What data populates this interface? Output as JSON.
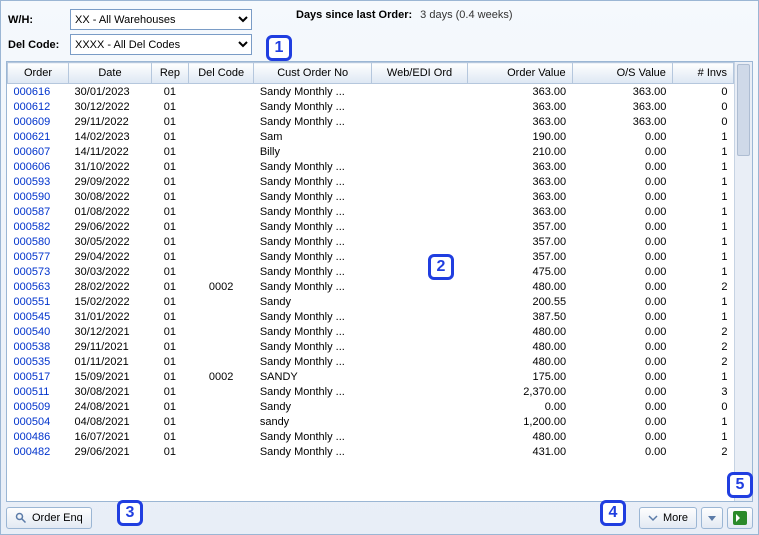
{
  "filters": {
    "wh_label": "W/H:",
    "wh_value": "XX - All Warehouses",
    "del_label": "Del Code:",
    "del_value": "XXXX - All Del Codes",
    "days_label": "Days since last Order:",
    "days_value": "3 days (0.4 weeks)"
  },
  "columns": [
    "Order",
    "Date",
    "Rep",
    "Del Code",
    "Cust Order No",
    "Web/EDI Ord",
    "Order Value",
    "O/S Value",
    "# Invs"
  ],
  "rows": [
    {
      "order": "000616",
      "date": "30/01/2023",
      "rep": "01",
      "del": "",
      "cust": "Sandy Monthly ...",
      "web": "",
      "ov": "363.00",
      "os": "363.00",
      "invs": "0"
    },
    {
      "order": "000612",
      "date": "30/12/2022",
      "rep": "01",
      "del": "",
      "cust": "Sandy Monthly ...",
      "web": "",
      "ov": "363.00",
      "os": "363.00",
      "invs": "0"
    },
    {
      "order": "000609",
      "date": "29/11/2022",
      "rep": "01",
      "del": "",
      "cust": "Sandy Monthly ...",
      "web": "",
      "ov": "363.00",
      "os": "363.00",
      "invs": "0"
    },
    {
      "order": "000621",
      "date": "14/02/2023",
      "rep": "01",
      "del": "",
      "cust": "Sam",
      "web": "",
      "ov": "190.00",
      "os": "0.00",
      "invs": "1"
    },
    {
      "order": "000607",
      "date": "14/11/2022",
      "rep": "01",
      "del": "",
      "cust": "Billy",
      "web": "",
      "ov": "210.00",
      "os": "0.00",
      "invs": "1"
    },
    {
      "order": "000606",
      "date": "31/10/2022",
      "rep": "01",
      "del": "",
      "cust": "Sandy Monthly ...",
      "web": "",
      "ov": "363.00",
      "os": "0.00",
      "invs": "1"
    },
    {
      "order": "000593",
      "date": "29/09/2022",
      "rep": "01",
      "del": "",
      "cust": "Sandy Monthly ...",
      "web": "",
      "ov": "363.00",
      "os": "0.00",
      "invs": "1"
    },
    {
      "order": "000590",
      "date": "30/08/2022",
      "rep": "01",
      "del": "",
      "cust": "Sandy Monthly ...",
      "web": "",
      "ov": "363.00",
      "os": "0.00",
      "invs": "1"
    },
    {
      "order": "000587",
      "date": "01/08/2022",
      "rep": "01",
      "del": "",
      "cust": "Sandy Monthly ...",
      "web": "",
      "ov": "363.00",
      "os": "0.00",
      "invs": "1"
    },
    {
      "order": "000582",
      "date": "29/06/2022",
      "rep": "01",
      "del": "",
      "cust": "Sandy Monthly ...",
      "web": "",
      "ov": "357.00",
      "os": "0.00",
      "invs": "1"
    },
    {
      "order": "000580",
      "date": "30/05/2022",
      "rep": "01",
      "del": "",
      "cust": "Sandy Monthly ...",
      "web": "",
      "ov": "357.00",
      "os": "0.00",
      "invs": "1"
    },
    {
      "order": "000577",
      "date": "29/04/2022",
      "rep": "01",
      "del": "",
      "cust": "Sandy Monthly ...",
      "web": "",
      "ov": "357.00",
      "os": "0.00",
      "invs": "1"
    },
    {
      "order": "000573",
      "date": "30/03/2022",
      "rep": "01",
      "del": "",
      "cust": "Sandy Monthly ...",
      "web": "",
      "ov": "475.00",
      "os": "0.00",
      "invs": "1"
    },
    {
      "order": "000563",
      "date": "28/02/2022",
      "rep": "01",
      "del": "0002",
      "cust": "Sandy Monthly ...",
      "web": "",
      "ov": "480.00",
      "os": "0.00",
      "invs": "2"
    },
    {
      "order": "000551",
      "date": "15/02/2022",
      "rep": "01",
      "del": "",
      "cust": "Sandy",
      "web": "",
      "ov": "200.55",
      "os": "0.00",
      "invs": "1"
    },
    {
      "order": "000545",
      "date": "31/01/2022",
      "rep": "01",
      "del": "",
      "cust": "Sandy Monthly ...",
      "web": "",
      "ov": "387.50",
      "os": "0.00",
      "invs": "1"
    },
    {
      "order": "000540",
      "date": "30/12/2021",
      "rep": "01",
      "del": "",
      "cust": "Sandy Monthly ...",
      "web": "",
      "ov": "480.00",
      "os": "0.00",
      "invs": "2"
    },
    {
      "order": "000538",
      "date": "29/11/2021",
      "rep": "01",
      "del": "",
      "cust": "Sandy Monthly ...",
      "web": "",
      "ov": "480.00",
      "os": "0.00",
      "invs": "2"
    },
    {
      "order": "000535",
      "date": "01/11/2021",
      "rep": "01",
      "del": "",
      "cust": "Sandy Monthly ...",
      "web": "",
      "ov": "480.00",
      "os": "0.00",
      "invs": "2"
    },
    {
      "order": "000517",
      "date": "15/09/2021",
      "rep": "01",
      "del": "0002",
      "cust": "SANDY",
      "web": "",
      "ov": "175.00",
      "os": "0.00",
      "invs": "1"
    },
    {
      "order": "000511",
      "date": "30/08/2021",
      "rep": "01",
      "del": "",
      "cust": "Sandy Monthly ...",
      "web": "",
      "ov": "2,370.00",
      "os": "0.00",
      "invs": "3"
    },
    {
      "order": "000509",
      "date": "24/08/2021",
      "rep": "01",
      "del": "",
      "cust": "Sandy",
      "web": "",
      "ov": "0.00",
      "os": "0.00",
      "invs": "0"
    },
    {
      "order": "000504",
      "date": "04/08/2021",
      "rep": "01",
      "del": "",
      "cust": "sandy",
      "web": "",
      "ov": "1,200.00",
      "os": "0.00",
      "invs": "1"
    },
    {
      "order": "000486",
      "date": "16/07/2021",
      "rep": "01",
      "del": "",
      "cust": "Sandy Monthly ...",
      "web": "",
      "ov": "480.00",
      "os": "0.00",
      "invs": "1"
    },
    {
      "order": "000482",
      "date": "29/06/2021",
      "rep": "01",
      "del": "",
      "cust": "Sandy Monthly ...",
      "web": "",
      "ov": "431.00",
      "os": "0.00",
      "invs": "2"
    }
  ],
  "footer": {
    "order_enq": "Order Enq",
    "more": "More"
  },
  "annotations": [
    "1",
    "2",
    "3",
    "4",
    "5"
  ]
}
